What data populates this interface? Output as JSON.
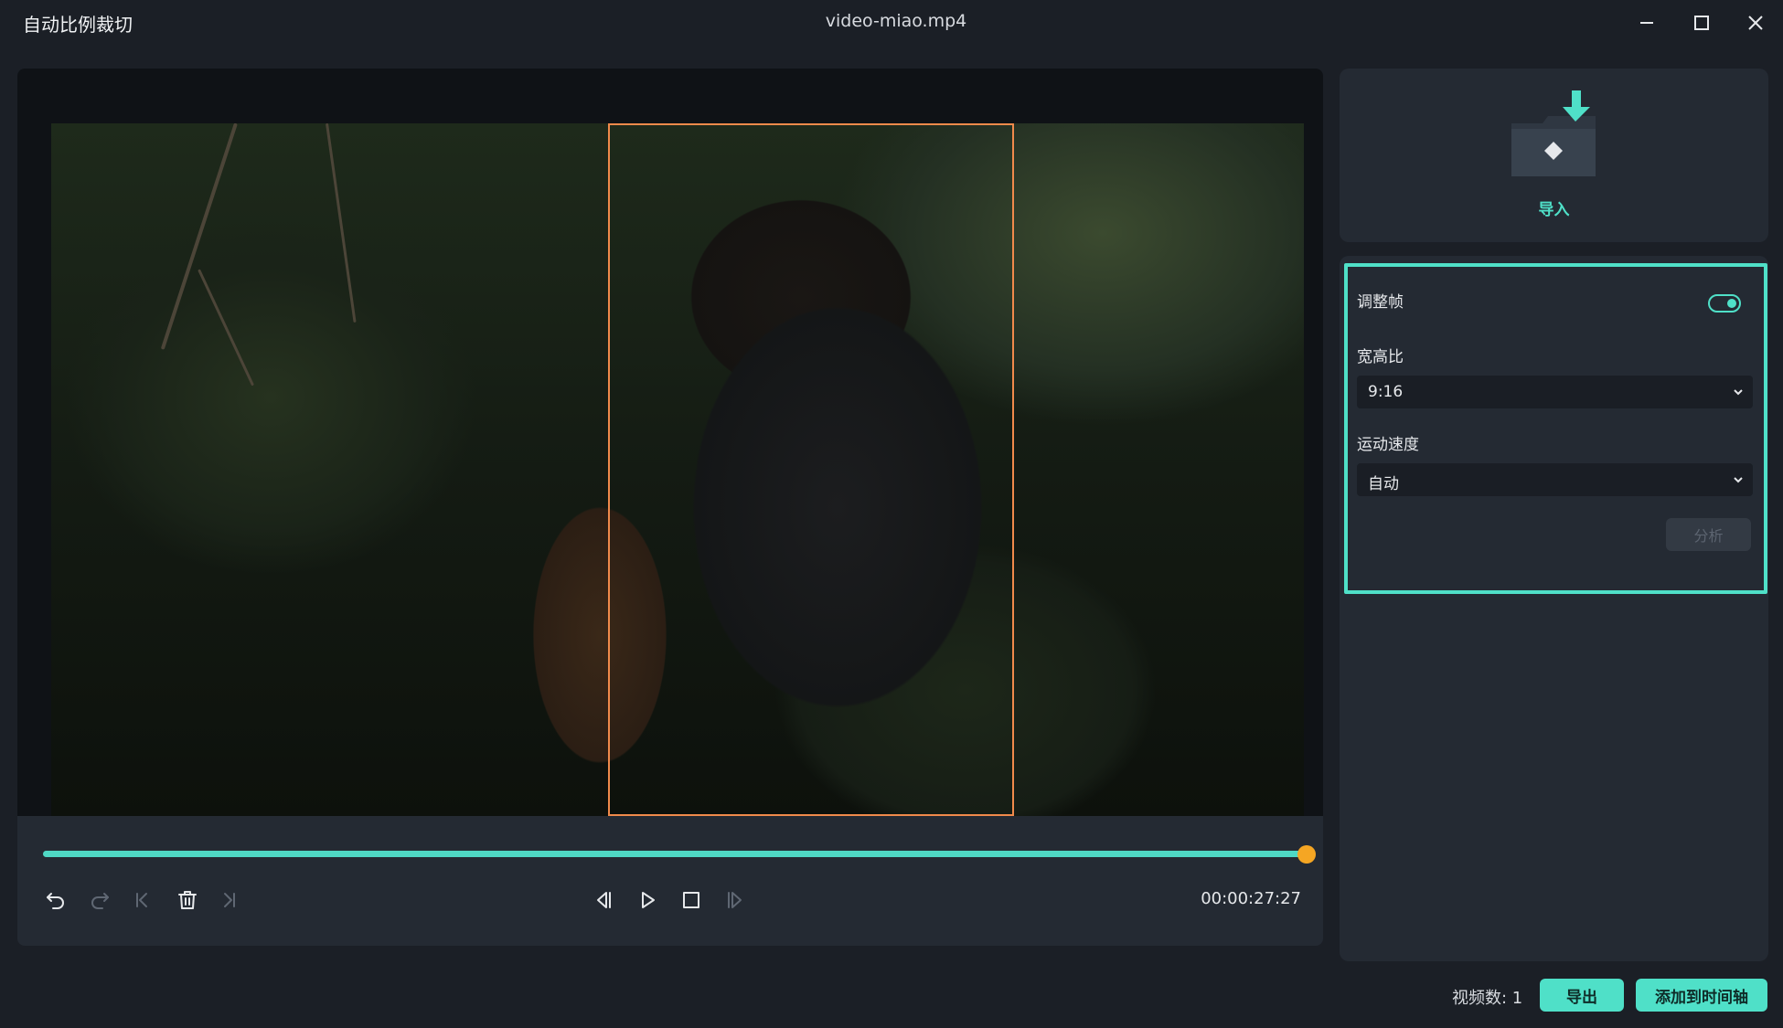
{
  "window": {
    "app_title": "自动比例裁切",
    "file_name": "video-miao.mp4",
    "minimize_icon": "minimize-icon",
    "maximize_icon": "maximize-icon",
    "close_icon": "close-icon"
  },
  "preview": {
    "crop_aspect": "9:16",
    "playhead_progress": 1.0,
    "timecode": "00:00:27:27",
    "controls": {
      "undo": {
        "icon": "undo-icon",
        "enabled": true
      },
      "redo": {
        "icon": "redo-icon",
        "enabled": false
      },
      "prev_keyframe": {
        "icon": "skip-start-icon",
        "enabled": false
      },
      "delete": {
        "icon": "trash-icon",
        "enabled": true
      },
      "next_keyframe": {
        "icon": "skip-end-icon",
        "enabled": false
      },
      "prev_frame": {
        "icon": "step-back-icon",
        "enabled": true
      },
      "play": {
        "icon": "play-icon",
        "enabled": true
      },
      "stop": {
        "icon": "stop-icon",
        "enabled": true
      },
      "next_frame": {
        "icon": "step-forward-icon",
        "enabled": false
      }
    }
  },
  "import": {
    "label": "导入",
    "icon": "import-folder-icon"
  },
  "settings": {
    "adjust_frame_label": "调整帧",
    "adjust_frame_on": true,
    "aspect_ratio_label": "宽高比",
    "aspect_ratio_value": "9:16",
    "motion_speed_label": "运动速度",
    "motion_speed_value": "自动",
    "analyze_label": "分析"
  },
  "footer": {
    "video_count_label": "视频数: 1",
    "export_label": "导出",
    "add_to_timeline_label": "添加到时间轴"
  },
  "colors": {
    "accent": "#4fe0c8",
    "crop_border": "#f08a4b",
    "playhead": "#f5a623",
    "background": "#1b1f26",
    "panel": "#242a33"
  }
}
